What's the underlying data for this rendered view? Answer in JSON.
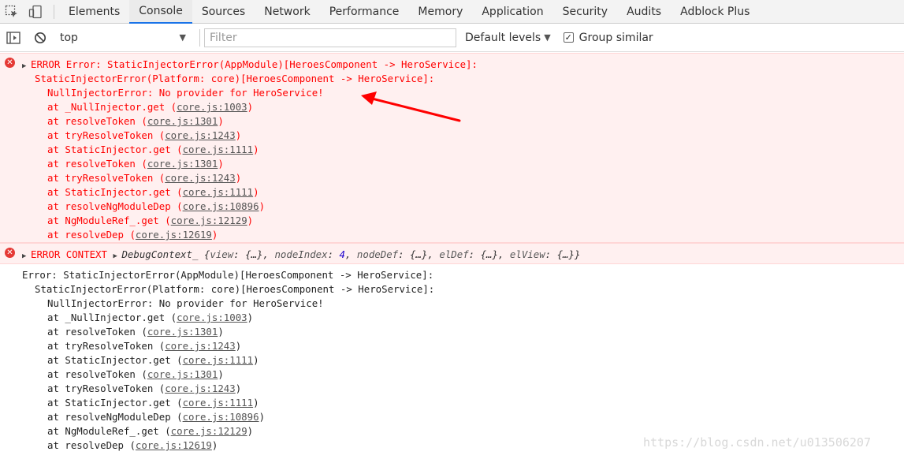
{
  "devtools": {
    "tabs": [
      "Elements",
      "Console",
      "Sources",
      "Network",
      "Performance",
      "Memory",
      "Application",
      "Security",
      "Audits",
      "Adblock Plus"
    ],
    "active_tab": "Console"
  },
  "toolbar": {
    "context": "top",
    "filter_placeholder": "Filter",
    "levels": "Default levels",
    "group_similar": "Group similar",
    "group_similar_checked": true
  },
  "error1": {
    "label": "ERROR",
    "line1": "Error: StaticInjectorError(AppModule)[HeroesComponent -> HeroService]:",
    "line2": "StaticInjectorError(Platform: core)[HeroesComponent -> HeroService]:",
    "line3": "NullInjectorError: No provider for HeroService!",
    "stack": [
      {
        "fn": "at _NullInjector.get",
        "loc": "core.js:1003"
      },
      {
        "fn": "at resolveToken",
        "loc": "core.js:1301"
      },
      {
        "fn": "at tryResolveToken",
        "loc": "core.js:1243"
      },
      {
        "fn": "at StaticInjector.get",
        "loc": "core.js:1111"
      },
      {
        "fn": "at resolveToken",
        "loc": "core.js:1301"
      },
      {
        "fn": "at tryResolveToken",
        "loc": "core.js:1243"
      },
      {
        "fn": "at StaticInjector.get",
        "loc": "core.js:1111"
      },
      {
        "fn": "at resolveNgModuleDep",
        "loc": "core.js:10896"
      },
      {
        "fn": "at NgModuleRef_.get",
        "loc": "core.js:12129"
      },
      {
        "fn": "at resolveDep",
        "loc": "core.js:12619"
      }
    ]
  },
  "error2": {
    "label": "ERROR CONTEXT",
    "class": "DebugContext_",
    "props": [
      {
        "key": "view",
        "value": "{…}"
      },
      {
        "key": "nodeIndex",
        "value": "4"
      },
      {
        "key": "nodeDef",
        "value": "{…}"
      },
      {
        "key": "elDef",
        "value": "{…}"
      },
      {
        "key": "elView",
        "value": "{…}"
      }
    ]
  },
  "log": {
    "line1": "Error: StaticInjectorError(AppModule)[HeroesComponent -> HeroService]:",
    "line2": "StaticInjectorError(Platform: core)[HeroesComponent -> HeroService]:",
    "line3": "NullInjectorError: No provider for HeroService!",
    "stack": [
      {
        "fn": "at _NullInjector.get",
        "loc": "core.js:1003"
      },
      {
        "fn": "at resolveToken",
        "loc": "core.js:1301"
      },
      {
        "fn": "at tryResolveToken",
        "loc": "core.js:1243"
      },
      {
        "fn": "at StaticInjector.get",
        "loc": "core.js:1111"
      },
      {
        "fn": "at resolveToken",
        "loc": "core.js:1301"
      },
      {
        "fn": "at tryResolveToken",
        "loc": "core.js:1243"
      },
      {
        "fn": "at StaticInjector.get",
        "loc": "core.js:1111"
      },
      {
        "fn": "at resolveNgModuleDep",
        "loc": "core.js:10896"
      },
      {
        "fn": "at NgModuleRef_.get",
        "loc": "core.js:12129"
      },
      {
        "fn": "at resolveDep",
        "loc": "core.js:12619"
      }
    ]
  },
  "watermark": "https://blog.csdn.net/u013506207",
  "colors": {
    "error_text": "#ff0000",
    "error_bg": "#fff0f0",
    "annotation_arrow": "#ff0000",
    "active_tab_underline": "#1a73e8"
  }
}
